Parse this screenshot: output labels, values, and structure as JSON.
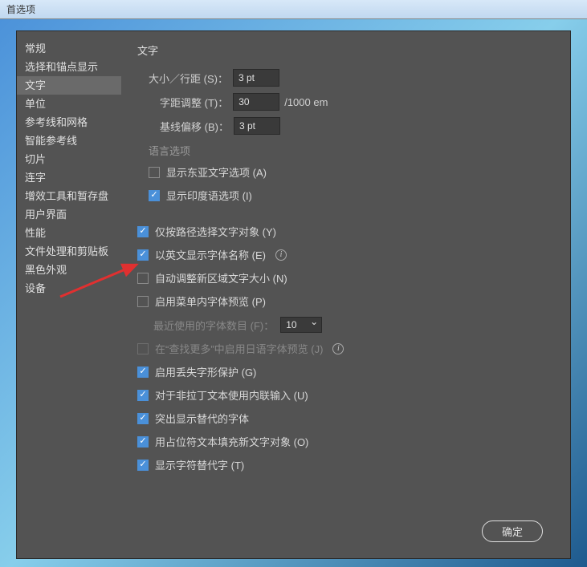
{
  "titlebar": {
    "title": "首选项"
  },
  "sidebar": {
    "items": [
      {
        "label": "常规"
      },
      {
        "label": "选择和锚点显示"
      },
      {
        "label": "文字"
      },
      {
        "label": "单位"
      },
      {
        "label": "参考线和网格"
      },
      {
        "label": "智能参考线"
      },
      {
        "label": "切片"
      },
      {
        "label": "连字"
      },
      {
        "label": "增效工具和暂存盘"
      },
      {
        "label": "用户界面"
      },
      {
        "label": "性能"
      },
      {
        "label": "文件处理和剪贴板"
      },
      {
        "label": "黑色外观"
      },
      {
        "label": "设备"
      }
    ],
    "selected_index": 2
  },
  "main": {
    "title": "文字",
    "fields": {
      "size_leading": {
        "label": "大小／行距 (S)：",
        "value": "3 pt"
      },
      "tracking": {
        "label": "字距调整 (T)：",
        "value": "30",
        "unit": "/1000 em"
      },
      "baseline": {
        "label": "基线偏移 (B)：",
        "value": "3 pt"
      }
    },
    "lang_section": {
      "title": "语言选项",
      "show_east_asian": {
        "label": "显示东亚文字选项 (A)",
        "checked": false
      },
      "show_indic": {
        "label": "显示印度语选项 (I)",
        "checked": true
      }
    },
    "options": {
      "select_by_path": {
        "label": "仅按路径选择文字对象 (Y)",
        "checked": true
      },
      "english_fonts": {
        "label": "以英文显示字体名称 (E)",
        "checked": true,
        "info": true
      },
      "auto_resize": {
        "label": "自动调整新区域文字大小 (N)",
        "checked": false
      },
      "menu_preview": {
        "label": "启用菜单内字体预览 (P)",
        "checked": false
      },
      "recent_fonts": {
        "label": "最近使用的字体数目 (F)：",
        "value": "10"
      },
      "jp_preview": {
        "label": "在“查找更多”中启用日语字体预览 (J)",
        "checked": false,
        "info": true
      },
      "missing_glyph": {
        "label": "启用丢失字形保护 (G)",
        "checked": true
      },
      "inline_input": {
        "label": "对于非拉丁文本使用内联输入 (U)",
        "checked": true
      },
      "highlight_sub": {
        "label": "突出显示替代的字体",
        "checked": true
      },
      "placeholder_fill": {
        "label": "用占位符文本填充新文字对象 (O)",
        "checked": true
      },
      "show_alt_glyphs": {
        "label": "显示字符替代字 (T)",
        "checked": true
      }
    }
  },
  "buttons": {
    "ok": "确定"
  }
}
